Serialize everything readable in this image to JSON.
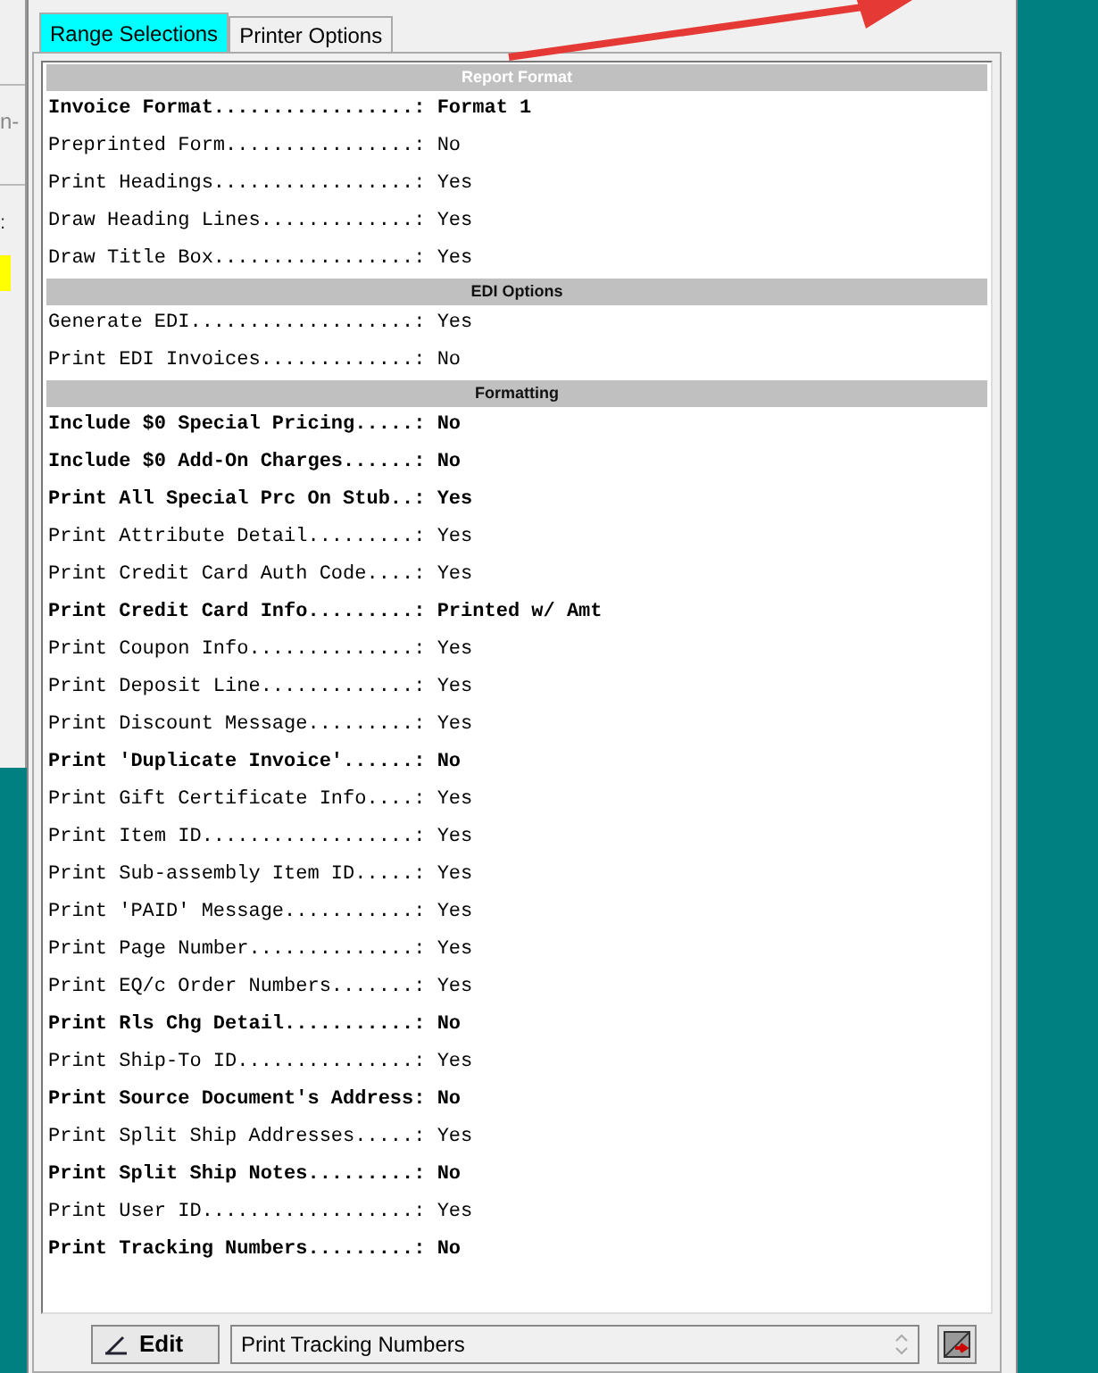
{
  "background_window": {
    "texts": [
      "n-",
      ":"
    ]
  },
  "tabs": [
    {
      "label": "Range Selections",
      "selected": true
    },
    {
      "label": "Printer Options",
      "selected": false
    }
  ],
  "sections": [
    {
      "title": "Report Format",
      "rows": [
        {
          "label": "Invoice Format.................:",
          "value": "Format 1",
          "bold": true
        },
        {
          "label": "Preprinted Form................:",
          "value": "No",
          "bold": false
        },
        {
          "label": "Print Headings.................:",
          "value": "Yes",
          "bold": false
        },
        {
          "label": "Draw Heading Lines.............:",
          "value": "Yes",
          "bold": false
        },
        {
          "label": "Draw Title Box.................:",
          "value": "Yes",
          "bold": false
        }
      ]
    },
    {
      "title": "EDI Options",
      "rows": [
        {
          "label": "Generate EDI...................:",
          "value": "Yes",
          "bold": false
        },
        {
          "label": "Print EDI Invoices.............:",
          "value": "No",
          "bold": false
        }
      ]
    },
    {
      "title": "Formatting",
      "rows": [
        {
          "label": "Include $0 Special Pricing.....:",
          "value": "No",
          "bold": true
        },
        {
          "label": "Include $0 Add-On Charges......:",
          "value": "No",
          "bold": true
        },
        {
          "label": "Print All Special Prc On Stub..:",
          "value": "Yes",
          "bold": true
        },
        {
          "label": "Print Attribute Detail.........:",
          "value": "Yes",
          "bold": false
        },
        {
          "label": "Print Credit Card Auth Code....:",
          "value": "Yes",
          "bold": false
        },
        {
          "label": "Print Credit Card Info.........:",
          "value": "Printed w/ Amt",
          "bold": true
        },
        {
          "label": "Print Coupon Info..............:",
          "value": "Yes",
          "bold": false
        },
        {
          "label": "Print Deposit Line.............:",
          "value": "Yes",
          "bold": false
        },
        {
          "label": "Print Discount Message.........:",
          "value": "Yes",
          "bold": false
        },
        {
          "label": "Print 'Duplicate Invoice'......:",
          "value": "No",
          "bold": true
        },
        {
          "label": "Print Gift Certificate Info....:",
          "value": "Yes",
          "bold": false
        },
        {
          "label": "Print Item ID..................:",
          "value": "Yes",
          "bold": false
        },
        {
          "label": "Print Sub-assembly Item ID.....:",
          "value": "Yes",
          "bold": false
        },
        {
          "label": "Print 'PAID' Message...........:",
          "value": "Yes",
          "bold": false
        },
        {
          "label": "Print Page Number..............:",
          "value": "Yes",
          "bold": false
        },
        {
          "label": "Print EQ/c Order Numbers.......:",
          "value": "Yes",
          "bold": false
        },
        {
          "label": "Print Rls Chg Detail...........:",
          "value": "No",
          "bold": true
        },
        {
          "label": "Print Ship-To ID...............:",
          "value": "Yes",
          "bold": false
        },
        {
          "label": "Print Source Document's Address:",
          "value": "No",
          "bold": true
        },
        {
          "label": "Print Split Ship Addresses.....:",
          "value": "Yes",
          "bold": false
        },
        {
          "label": "Print Split Ship Notes.........:",
          "value": "No",
          "bold": true
        },
        {
          "label": "Print User ID..................:",
          "value": "Yes",
          "bold": false
        },
        {
          "label": "Print Tracking Numbers.........:",
          "value": "No",
          "bold": true
        }
      ]
    }
  ],
  "edit_button": "Edit",
  "description_field": {
    "value": "Print Tracking Numbers"
  }
}
